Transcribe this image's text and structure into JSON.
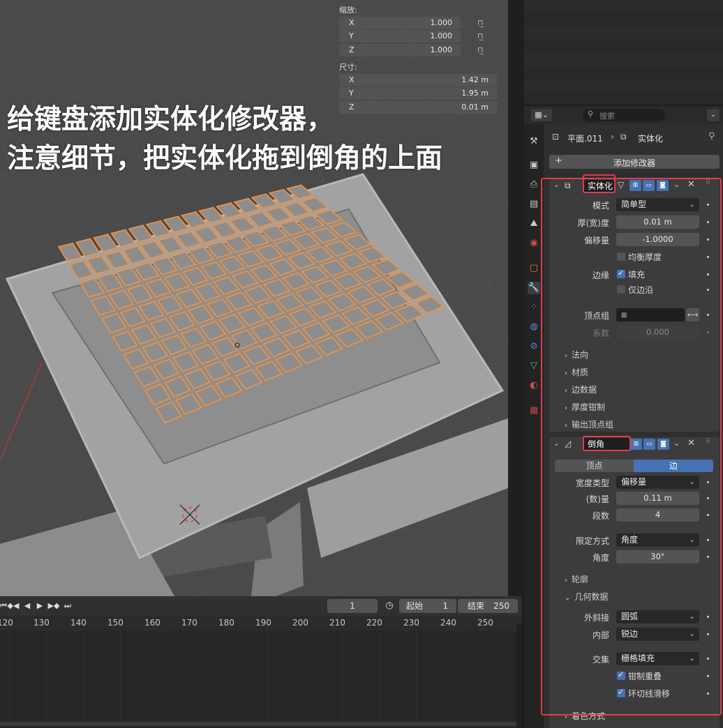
{
  "viewport": {
    "scale_title": "缩放:",
    "scale": [
      {
        "axis": "X",
        "value": "1.000"
      },
      {
        "axis": "Y",
        "value": "1.000"
      },
      {
        "axis": "Z",
        "value": "1.000"
      }
    ],
    "dims_title": "尺寸:",
    "dims": [
      {
        "axis": "X",
        "value": "1.42 m"
      },
      {
        "axis": "Y",
        "value": "1.95 m"
      },
      {
        "axis": "Z",
        "value": "0.01 m"
      }
    ],
    "overlay_line1": "给键盘添加实体化修改器，",
    "overlay_line2": "注意细节，把实体化拖到倒角的上面",
    "selection_color": "#f5923e",
    "bg_color": "#4a4a4a"
  },
  "timeline": {
    "current_frame": "1",
    "start_label": "起始",
    "start_value": "1",
    "end_label": "结束",
    "end_value": "250",
    "ticks": [
      "120",
      "130",
      "140",
      "150",
      "160",
      "170",
      "180",
      "190",
      "200",
      "210",
      "220",
      "230",
      "240",
      "250"
    ]
  },
  "properties": {
    "search_placeholder": "搜索",
    "breadcrumb_object": "平面.011",
    "breadcrumb_modifier": "实体化",
    "add_modifier": "添加修改器",
    "solidify": {
      "name": "实体化",
      "mode_label": "模式",
      "mode_value": "简单型",
      "thickness_label": "厚(宽)度",
      "thickness_value": "0.01 m",
      "offset_label": "偏移量",
      "offset_value": "-1.0000",
      "even_thickness": "均衡厚度",
      "rim_label": "边缘",
      "fill": "填充",
      "only_rim": "仅边沿",
      "vgroup_label": "顶点组",
      "factor_label": "系数",
      "factor_value": "0.000",
      "sub_normals": "法向",
      "sub_materials": "材质",
      "sub_edge_data": "边数据",
      "sub_thickness_clamp": "厚度钳制",
      "sub_output_vgroups": "输出顶点组"
    },
    "bevel": {
      "name": "倒角",
      "tab_vertices": "顶点",
      "tab_edges": "边",
      "width_type_label": "宽度类型",
      "width_type_value": "偏移量",
      "amount_label": "(数)量",
      "amount_value": "0.11 m",
      "segments_label": "段数",
      "segments_value": "4",
      "limit_label": "限定方式",
      "limit_value": "角度",
      "angle_label": "角度",
      "angle_value": "30°",
      "sub_profile": "轮廓",
      "sub_geometry": "几何数据",
      "miter_outer_label": "外斜接",
      "miter_outer_value": "圆弧",
      "inner_label": "内部",
      "inner_value": "锐边",
      "intersect_label": "交集",
      "intersect_value": "栅格填充",
      "clamp_overlap": "钳制重叠",
      "loop_slide": "环切线滑移",
      "sub_shading": "着色方式"
    },
    "accent_color": "#4772b3",
    "highlight_color": "#e23b4e"
  }
}
